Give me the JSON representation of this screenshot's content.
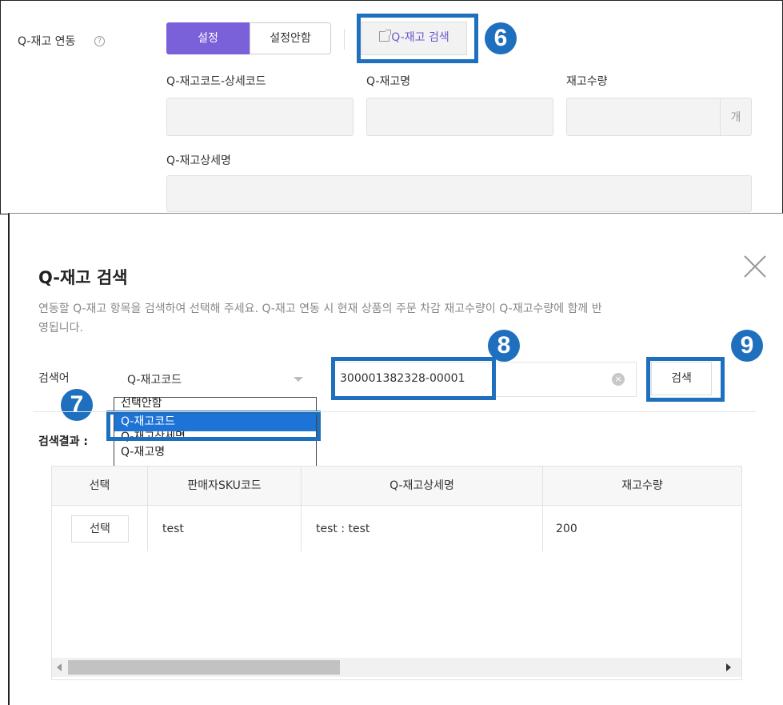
{
  "settings": {
    "qstock_link_label": "Q-재고 연동",
    "help_symbol": "?",
    "toggle_on": "설정",
    "toggle_off": "설정안함",
    "qstock_search_button": "Q-재고 검색",
    "field_code_label": "Q-재고코드-상세코드",
    "field_name_label": "Q-재고명",
    "field_qty_label": "재고수량",
    "field_qty_unit": "개",
    "field_detail_label": "Q-재고상세명"
  },
  "callouts": [
    "6",
    "7",
    "8",
    "9"
  ],
  "modal": {
    "title": "Q-재고 검색",
    "description_line1": "연동할 Q-재고 항목을 검색하여 선택해 주세요. Q-재고 연동 시 현재 상품의 주문 차감 재고수량이 Q-재고수량에 함께 반",
    "description_line2": "영됩니다.",
    "search_label": "검색어",
    "select_value": "Q-재고코드",
    "dropdown_options": [
      "선택안함",
      "Q-재고코드",
      "Q-재고상세명",
      "Q-재고명"
    ],
    "search_input_value": "300001382328-00001",
    "search_button": "검색",
    "results_label": "검색결과 :",
    "table": {
      "headers": [
        "선택",
        "판매자SKU코드",
        "Q-재고상세명",
        "재고수량"
      ],
      "rows": [
        {
          "select_button": "선택",
          "sku": "test",
          "detail_name": "test : test",
          "qty": "200"
        }
      ]
    }
  },
  "colors": {
    "accent_purple": "#7b61d9",
    "callout_blue": "#1f6fbf",
    "dropdown_highlight": "#1e73d6"
  }
}
